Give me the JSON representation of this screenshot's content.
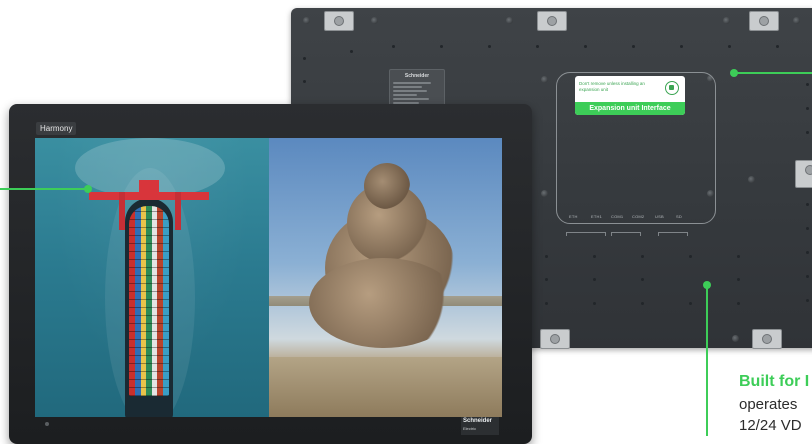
{
  "front_panel": {
    "screen_title": "Harmony",
    "brand_badge": "Schneider",
    "brand_badge_sub": "Electric"
  },
  "back_panel": {
    "label_brand": "Schneider",
    "expansion_sticker": {
      "warning": "Don't remove unless installing an expansion unit",
      "title": "Expansion unit Interface"
    },
    "ports": [
      "ETH",
      "ETH1",
      "COM1",
      "COM2",
      "USB",
      "SD"
    ]
  },
  "feature": {
    "title": "Built for I",
    "body_line1": "operates",
    "body_line2": "12/24 VD"
  },
  "colors": {
    "accent": "#3dcd58"
  }
}
